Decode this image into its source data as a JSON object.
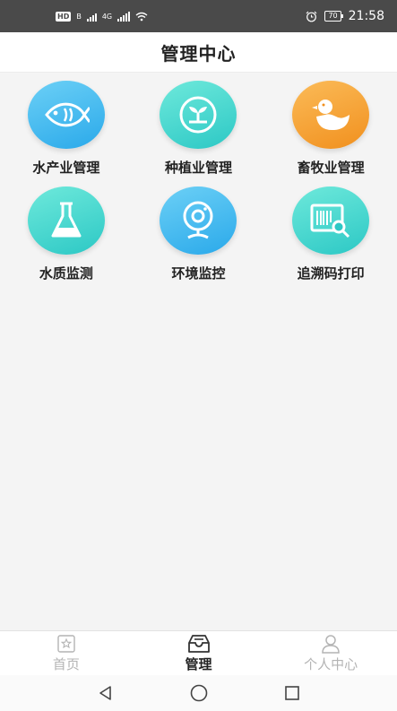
{
  "status_bar": {
    "network_badge": "HD",
    "network_sub": "B",
    "network_type": "4G",
    "battery": "70",
    "time": "21:58"
  },
  "header": {
    "title": "管理中心"
  },
  "modules": [
    {
      "label": "水产业管理",
      "icon": "fish-icon",
      "color": "#2aa9ea"
    },
    {
      "label": "种植业管理",
      "icon": "sprout-icon",
      "color": "#2cc8c5"
    },
    {
      "label": "畜牧业管理",
      "icon": "duck-icon",
      "color": "#f1901e"
    },
    {
      "label": "水质监测",
      "icon": "flask-icon",
      "color": "#2cc8c5"
    },
    {
      "label": "环境监控",
      "icon": "camera-icon",
      "color": "#2aa9ea"
    },
    {
      "label": "追溯码打印",
      "icon": "barcode-search-icon",
      "color": "#2cc8c5"
    }
  ],
  "bottom_nav": {
    "home_label": "首页",
    "manage_label": "管理",
    "profile_label": "个人中心",
    "active": "manage"
  },
  "colors": {
    "accent_blue": "#2aa9ea",
    "accent_teal": "#2cc8c5",
    "accent_orange": "#f1901e",
    "status_bar": "#4a4a4a"
  }
}
